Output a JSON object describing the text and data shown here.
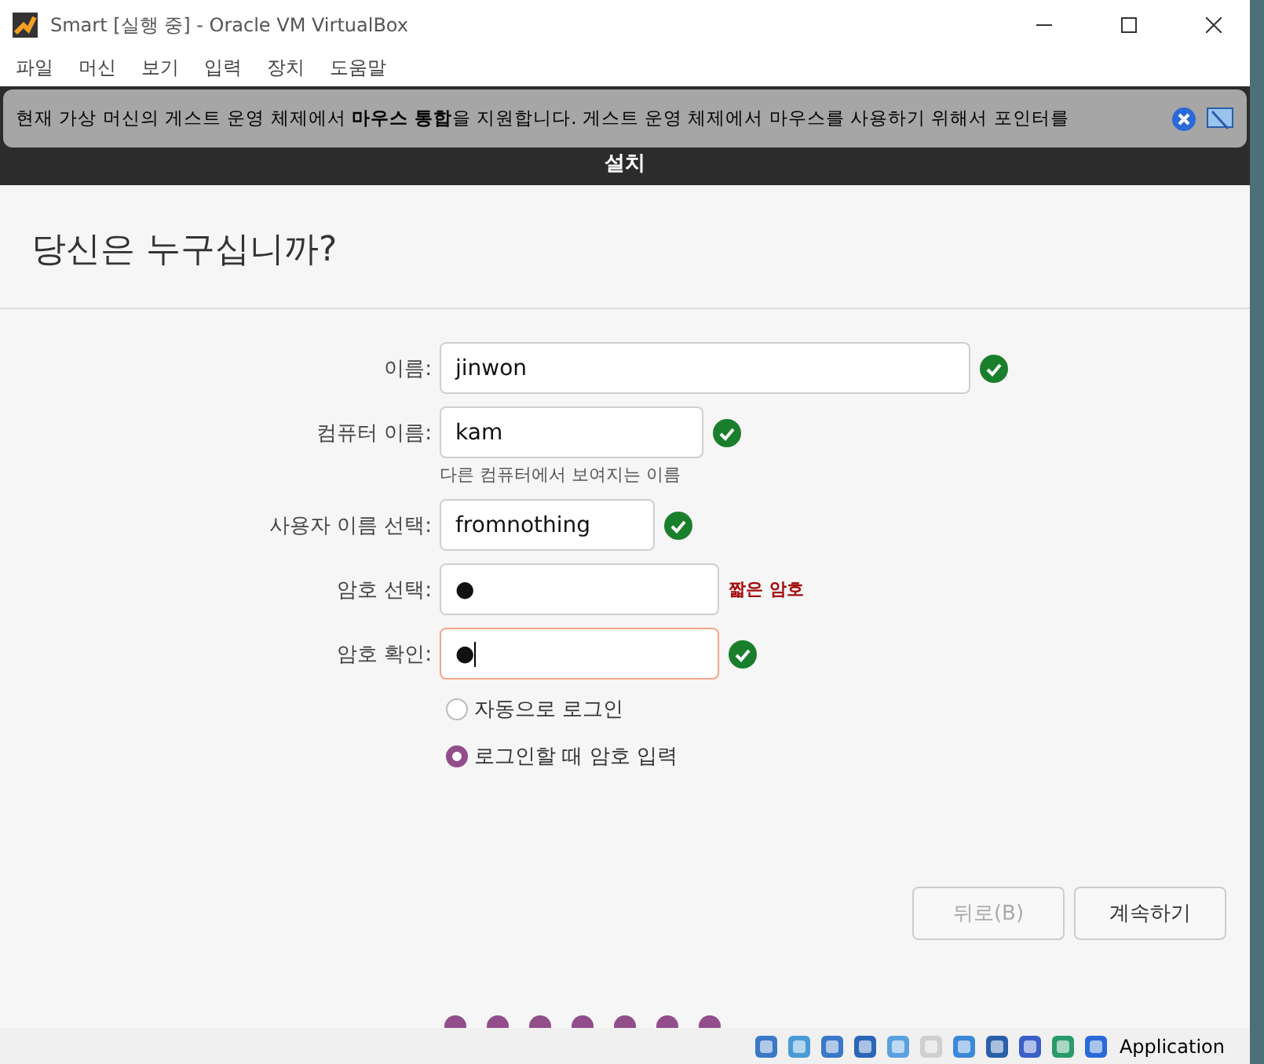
{
  "window": {
    "title": "Smart [실행 중] - Oracle VM VirtualBox"
  },
  "menu": [
    "파일",
    "머신",
    "보기",
    "입력",
    "장치",
    "도움말"
  ],
  "notification": {
    "text": "현재 가상 머신의 게스트 운영 체제에서 **마우스 통합**을 지원합니다. 게스트 운영 체제에서 마우스를 사용하기 위해서 포인터를"
  },
  "installer": {
    "title": "설치",
    "heading": "당신은 누구십니까?",
    "fields": [
      {
        "label": "이름:",
        "value": "jinwon",
        "kind": "valid",
        "focused": false
      },
      {
        "label": "컴퓨터 이름:",
        "value": "kam",
        "kind": "valid",
        "focused": false,
        "hint": "다른 컴퓨터에서 보여지는 이름"
      },
      {
        "label": "사용자 이름 선택:",
        "value": "fromnothing",
        "kind": "valid",
        "focused": false
      },
      {
        "label": "암호 선택:",
        "value": "●",
        "kind": "warning",
        "status_text": "짧은 암호",
        "focused": false
      },
      {
        "label": "암호 확인:",
        "value": "●",
        "kind": "valid",
        "focused": true
      }
    ],
    "options": [
      {
        "label": "자동으로 로그인",
        "selected": false
      },
      {
        "label": "로그인할 때 암호 입력",
        "selected": true
      }
    ],
    "buttons": [
      {
        "label": "뒤로(B)",
        "disabled": true
      },
      {
        "label": "계속하기",
        "disabled": false
      }
    ]
  },
  "status_bar": {
    "text": "Application"
  }
}
